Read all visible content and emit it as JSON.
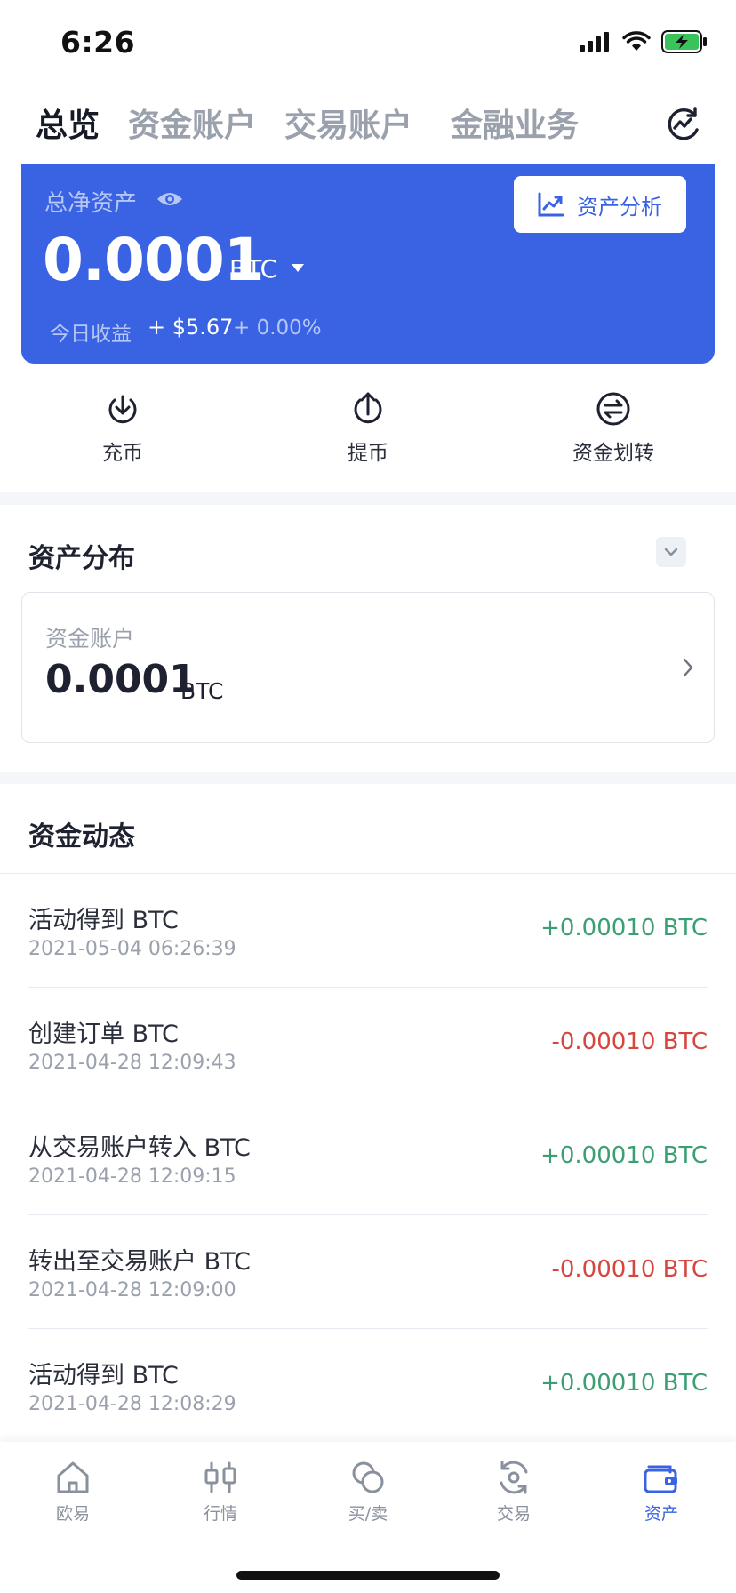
{
  "status_bar": {
    "time": "6:26"
  },
  "tabs": [
    {
      "label": "总览",
      "active": true
    },
    {
      "label": "资金账户",
      "active": false
    },
    {
      "label": "交易账户",
      "active": false
    },
    {
      "label": "金融业务",
      "active": false
    }
  ],
  "asset_card": {
    "label": "总净资产",
    "value": "0.0001",
    "unit": "BTC",
    "analysis_label": "资产分析",
    "today_label": "今日收益",
    "today_pnl": "+ $5.67",
    "today_pct": "+ 0.00%",
    "color": "#3a63e3"
  },
  "quick_actions": [
    {
      "label": "充币",
      "icon": "deposit-icon"
    },
    {
      "label": "提币",
      "icon": "withdraw-icon"
    },
    {
      "label": "资金划转",
      "icon": "transfer-icon"
    }
  ],
  "distribution": {
    "title": "资产分布",
    "account_label": "资金账户",
    "account_value": "0.0001",
    "account_unit": "BTC"
  },
  "activity": {
    "title": "资金动态",
    "items": [
      {
        "title": "活动得到 BTC",
        "time": "2021-05-04 06:26:39",
        "amount": "+0.00010 BTC",
        "direction": "positive"
      },
      {
        "title": "创建订单 BTC",
        "time": "2021-04-28 12:09:43",
        "amount": "-0.00010 BTC",
        "direction": "negative"
      },
      {
        "title": "从交易账户转入 BTC",
        "time": "2021-04-28 12:09:15",
        "amount": "+0.00010 BTC",
        "direction": "positive"
      },
      {
        "title": "转出至交易账户 BTC",
        "time": "2021-04-28 12:09:00",
        "amount": "-0.00010 BTC",
        "direction": "negative"
      },
      {
        "title": "活动得到 BTC",
        "time": "2021-04-28 12:08:29",
        "amount": "+0.00010 BTC",
        "direction": "positive"
      }
    ]
  },
  "bottom_nav": [
    {
      "label": "欧易",
      "icon": "home-icon",
      "active": false
    },
    {
      "label": "行情",
      "icon": "candlestick-icon",
      "active": false
    },
    {
      "label": "买/卖",
      "icon": "coins-icon",
      "active": false
    },
    {
      "label": "交易",
      "icon": "trade-cycle-icon",
      "active": false
    },
    {
      "label": "资产",
      "icon": "wallet-icon",
      "active": true
    }
  ],
  "colors": {
    "accent": "#3a63e3",
    "positive": "#3c9f73",
    "negative": "#d6463f"
  }
}
